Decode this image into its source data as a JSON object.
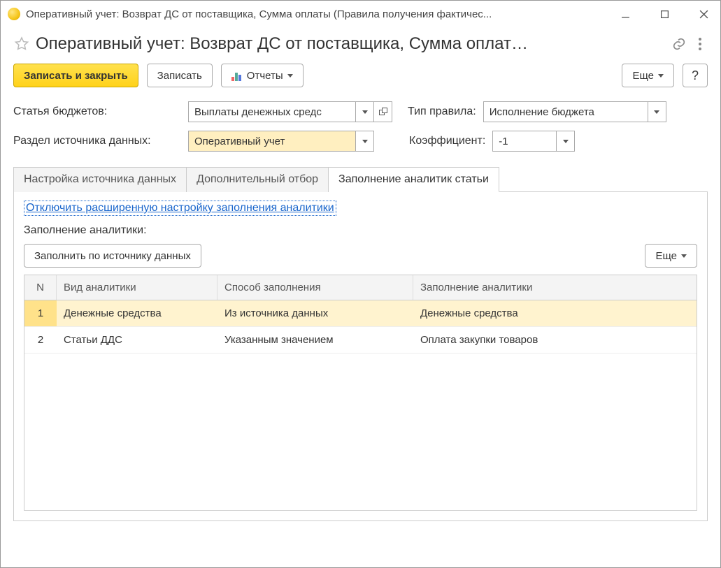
{
  "window": {
    "title": "Оперативный учет: Возврат ДС от поставщика, Сумма оплаты (Правила получения фактичес..."
  },
  "header": {
    "title": "Оперативный учет: Возврат ДС от поставщика, Сумма оплат…"
  },
  "toolbar": {
    "save_close": "Записать и закрыть",
    "save": "Записать",
    "reports": "Отчеты",
    "more": "Еще",
    "help": "?"
  },
  "fields": {
    "budget_item_label": "Статья бюджетов:",
    "budget_item_value": "Выплаты денежных средс",
    "rule_type_label": "Тип правила:",
    "rule_type_value": "Исполнение бюджета",
    "source_section_label": "Раздел источника данных:",
    "source_section_value": "Оперативный учет",
    "coefficient_label": "Коэффициент:",
    "coefficient_value": "-1"
  },
  "tabs": {
    "items": [
      {
        "label": "Настройка источника данных"
      },
      {
        "label": "Дополнительный отбор"
      },
      {
        "label": "Заполнение аналитик статьи"
      }
    ],
    "active": 2
  },
  "analytics": {
    "disable_link": "Отключить расширенную настройку заполнения аналитики",
    "section_label": "Заполнение аналитики:",
    "fill_by_source": "Заполнить по источнику данных",
    "more": "Еще",
    "columns": {
      "n": "N",
      "kind": "Вид аналитики",
      "method": "Способ заполнения",
      "fill": "Заполнение аналитики"
    },
    "rows": [
      {
        "n": "1",
        "kind": "Денежные средства",
        "method": "Из источника данных",
        "fill": "Денежные средства",
        "selected": true
      },
      {
        "n": "2",
        "kind": "Статьи ДДС",
        "method": "Указанным значением",
        "fill": "Оплата закупки товаров",
        "selected": false
      }
    ]
  }
}
